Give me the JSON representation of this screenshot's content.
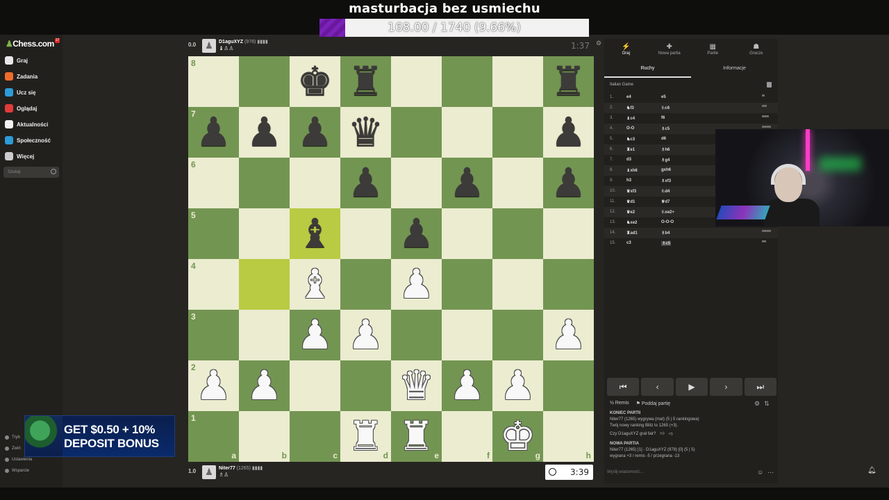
{
  "overlay": {
    "title": "masturbacja bez usmiechu",
    "goal_text": "168.00 / 1740 (9.66%)",
    "goal_fraction": 0.0966
  },
  "sidebar": {
    "logo": "Chess.com",
    "badge": "17",
    "items": [
      {
        "label": "Graj",
        "icon": "play-icon",
        "color": "#e8e8e8"
      },
      {
        "label": "Zadania",
        "icon": "puzzle-icon",
        "color": "#f06b2b"
      },
      {
        "label": "Ucz się",
        "icon": "learn-icon",
        "color": "#2d9bd8"
      },
      {
        "label": "Oglądaj",
        "icon": "watch-icon",
        "color": "#e03b3b"
      },
      {
        "label": "Aktualności",
        "icon": "news-icon",
        "color": "#f3f3f3"
      },
      {
        "label": "Społeczność",
        "icon": "community-icon",
        "color": "#2d9bd8"
      },
      {
        "label": "Więcej",
        "icon": "more-icon",
        "color": "#cccccc"
      }
    ],
    "search_placeholder": "Szukaj",
    "bottom": [
      "Tryb",
      "Zwiń",
      "Ustawienia",
      "Wsparcie"
    ]
  },
  "ad": {
    "line1": "GET $0.50 + 10%",
    "line2": "DEPOSIT BONUS"
  },
  "top_player": {
    "score": "0.0",
    "name": "D1aguXYZ",
    "rating": "(978)",
    "flags": "▮▮▮▮",
    "material": "♝♙♙",
    "clock": "1:37"
  },
  "bottom_player": {
    "score": "1.0",
    "name": "Niter77",
    "rating": "(1265)",
    "flags": "▮▮▮▮",
    "material": "♗♙",
    "clock": "3:39"
  },
  "board": {
    "files": [
      "a",
      "b",
      "c",
      "d",
      "e",
      "f",
      "g",
      "h"
    ],
    "ranks": [
      "8",
      "7",
      "6",
      "5",
      "4",
      "3",
      "2",
      "1"
    ],
    "highlight": [
      "c5",
      "b4"
    ],
    "pieces": {
      "c8": "bK",
      "d8": "bR",
      "h8": "bR",
      "a7": "bP",
      "b7": "bP",
      "c7": "bP",
      "d7": "bQ",
      "h7": "bP",
      "d6": "bP",
      "f6": "bP",
      "h6": "bP",
      "c5": "bB",
      "e5": "bP",
      "c4": "wB",
      "e4": "wP",
      "c3": "wP",
      "d3": "wP",
      "h3": "wP",
      "a2": "wP",
      "b2": "wP",
      "e2": "wQ",
      "f2": "wP",
      "g2": "wP",
      "d1": "wR",
      "e1": "wR",
      "g1": "wK"
    }
  },
  "right_panel": {
    "tabs": [
      {
        "label": "Graj",
        "icon": "bolt-icon"
      },
      {
        "label": "Nowa partia",
        "icon": "plus-icon"
      },
      {
        "label": "Partie",
        "icon": "board-icon"
      },
      {
        "label": "Gracze",
        "icon": "players-icon"
      }
    ],
    "subtabs": [
      "Ruchy",
      "Informacje"
    ],
    "opening": "Italian Game",
    "moves": [
      {
        "n": "1.",
        "w": "e4",
        "b": "e5"
      },
      {
        "n": "2.",
        "w": "♞f3",
        "b": "♘c6"
      },
      {
        "n": "3.",
        "w": "♝c4",
        "b": "f6"
      },
      {
        "n": "4.",
        "w": "O-O",
        "b": "♗c5"
      },
      {
        "n": "5.",
        "w": "♞c3",
        "b": "d6"
      },
      {
        "n": "6.",
        "w": "♜e1",
        "b": "♗h6"
      },
      {
        "n": "7.",
        "w": "d3",
        "b": "♗g4"
      },
      {
        "n": "8.",
        "w": "♝xh6",
        "b": "gxh6"
      },
      {
        "n": "9.",
        "w": "h3",
        "b": "♗xf3"
      },
      {
        "n": "10.",
        "w": "♛xf3",
        "b": "♘d4"
      },
      {
        "n": "11.",
        "w": "♛d1",
        "b": "♕d7"
      },
      {
        "n": "12.",
        "w": "♛e2",
        "b": "♘xe2+"
      },
      {
        "n": "13.",
        "w": "♞xe2",
        "b": "O-O-O"
      },
      {
        "n": "14.",
        "w": "♜ad1",
        "b": "♗b4"
      },
      {
        "n": "15.",
        "w": "c3",
        "b": "♗c5"
      }
    ],
    "nav": [
      "⏮",
      "‹",
      "▶",
      "›",
      "⏭"
    ],
    "actions": [
      "½ Remis",
      "⚑ Poddaj partię"
    ],
    "chat": {
      "end_header": "KONIEC PARTII",
      "end_line1": "Niter77 (1265) wygrywa (mat) (5 | 5 rankingowa)",
      "end_line2": "Twój nowy ranking Blitz to 1265 (+3).",
      "fair_q": "Czy D1aguXYZ grał fair?",
      "new_header": "NOWA PARTIA",
      "new_line1": "Niter77 (1265) [1] - D1aguXYZ (978) [0] (5 | 5)",
      "new_line2": "wygrana +3 / remis -5 / przegrana -13",
      "input_placeholder": "Wyślij wiadomość..."
    }
  }
}
